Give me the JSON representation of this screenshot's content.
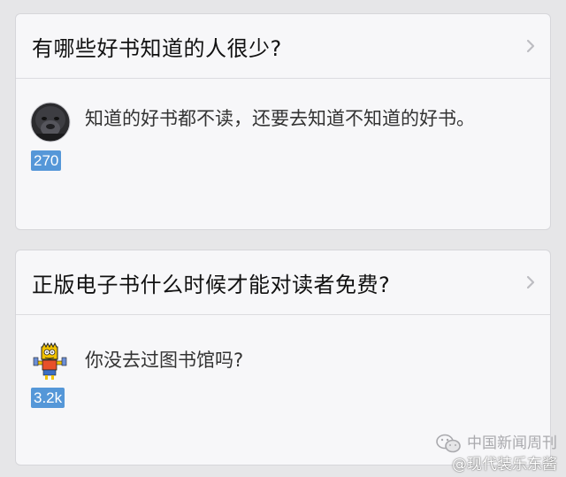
{
  "cards": [
    {
      "question": "有哪些好书知道的人很少?",
      "answer_text": "知道的好书都不读，还要去知道不知道的好书。",
      "votes": "270",
      "avatar_icon": "gorilla-avatar-icon"
    },
    {
      "question": "正版电子书什么时候才能对读者免费?",
      "answer_text": "你没去过图书馆吗?",
      "votes": "3.2k",
      "avatar_icon": "cartoon-character-avatar-icon"
    }
  ],
  "watermark": {
    "line1": "中国新闻周刊",
    "line2": "@现代装乐东酱"
  },
  "colors": {
    "background": "#e6e6e8",
    "card": "#f7f7f9",
    "vote_badge": "#5597d8",
    "chevron": "#bdbdc2"
  }
}
